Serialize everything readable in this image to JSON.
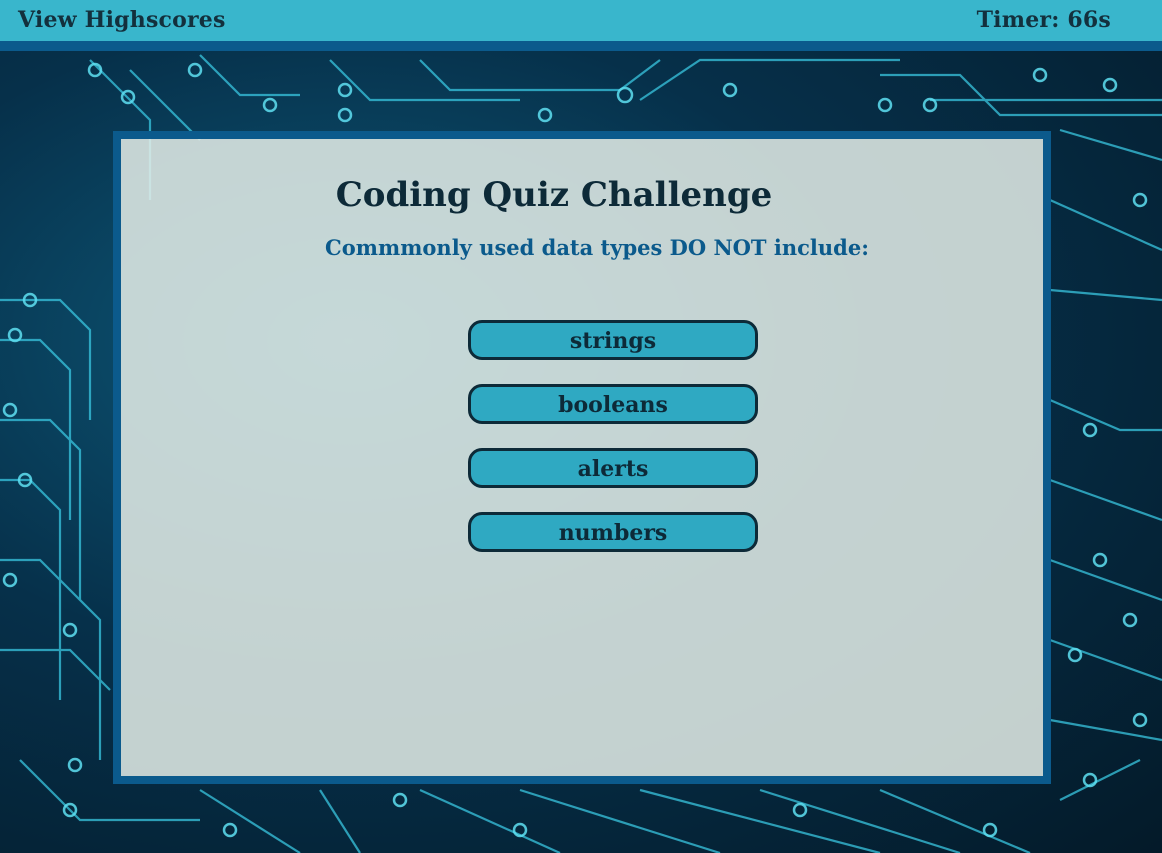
{
  "header": {
    "highscores_label": "View Highscores",
    "timer_text": "Timer: 66s"
  },
  "quiz": {
    "title": "Coding Quiz Challenge",
    "question": "Commmonly used data types DO NOT include:",
    "answers": [
      "strings",
      "booleans",
      "alerts",
      "numbers"
    ]
  },
  "colors": {
    "header_bg": "#39b6cc",
    "accent_blue": "#0b5a8c",
    "button_bg": "#2fa9c2",
    "text_dark": "#0d2a38"
  }
}
